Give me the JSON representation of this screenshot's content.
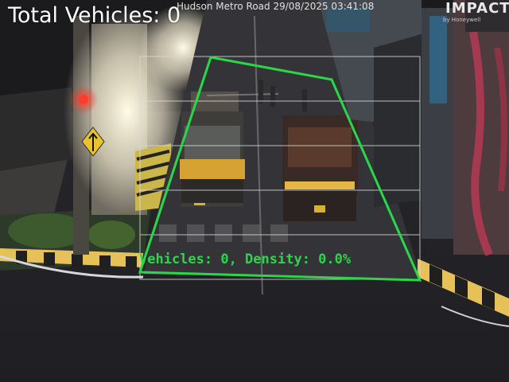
{
  "overlay": {
    "title": "Total Vehicles: 0",
    "timestamp": "Hudson Metro Road 29/08/2025 03:41:08",
    "vehicle_stats": "Vehicles: 0, Density: 0.0%",
    "zone_color": "#2bd64a",
    "grid_color": "#d8d8d8",
    "text_color": "#ffffff"
  },
  "signage": {
    "brand": "IMPACT",
    "brand_sub": "by Honeywell"
  }
}
